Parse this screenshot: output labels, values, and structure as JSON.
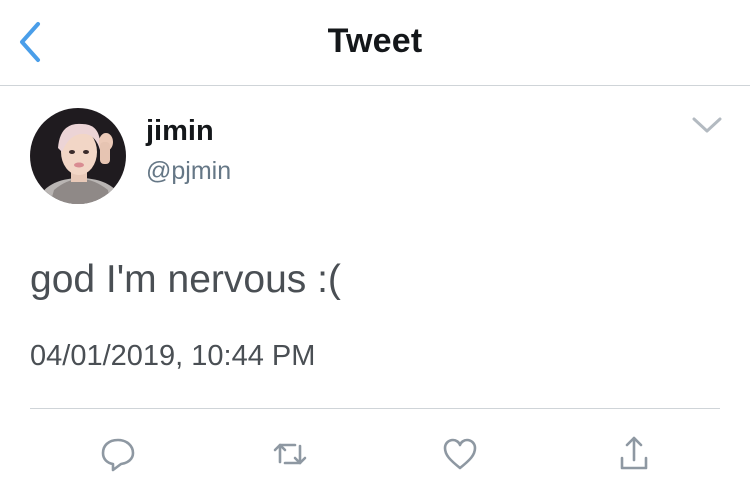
{
  "header": {
    "title": "Tweet"
  },
  "tweet": {
    "author_name": "jimin",
    "author_handle": "@pjmin",
    "text": "god I'm nervous :(",
    "timestamp": "04/01/2019, 10:44 PM"
  },
  "colors": {
    "accent": "#4a9ee9",
    "text": "#14171a",
    "secondary_text": "#657786",
    "icon_gray": "#8e98a2",
    "divider": "#cfd4d8"
  },
  "actions": [
    "reply-icon",
    "retweet-icon",
    "like-icon",
    "share-icon"
  ]
}
